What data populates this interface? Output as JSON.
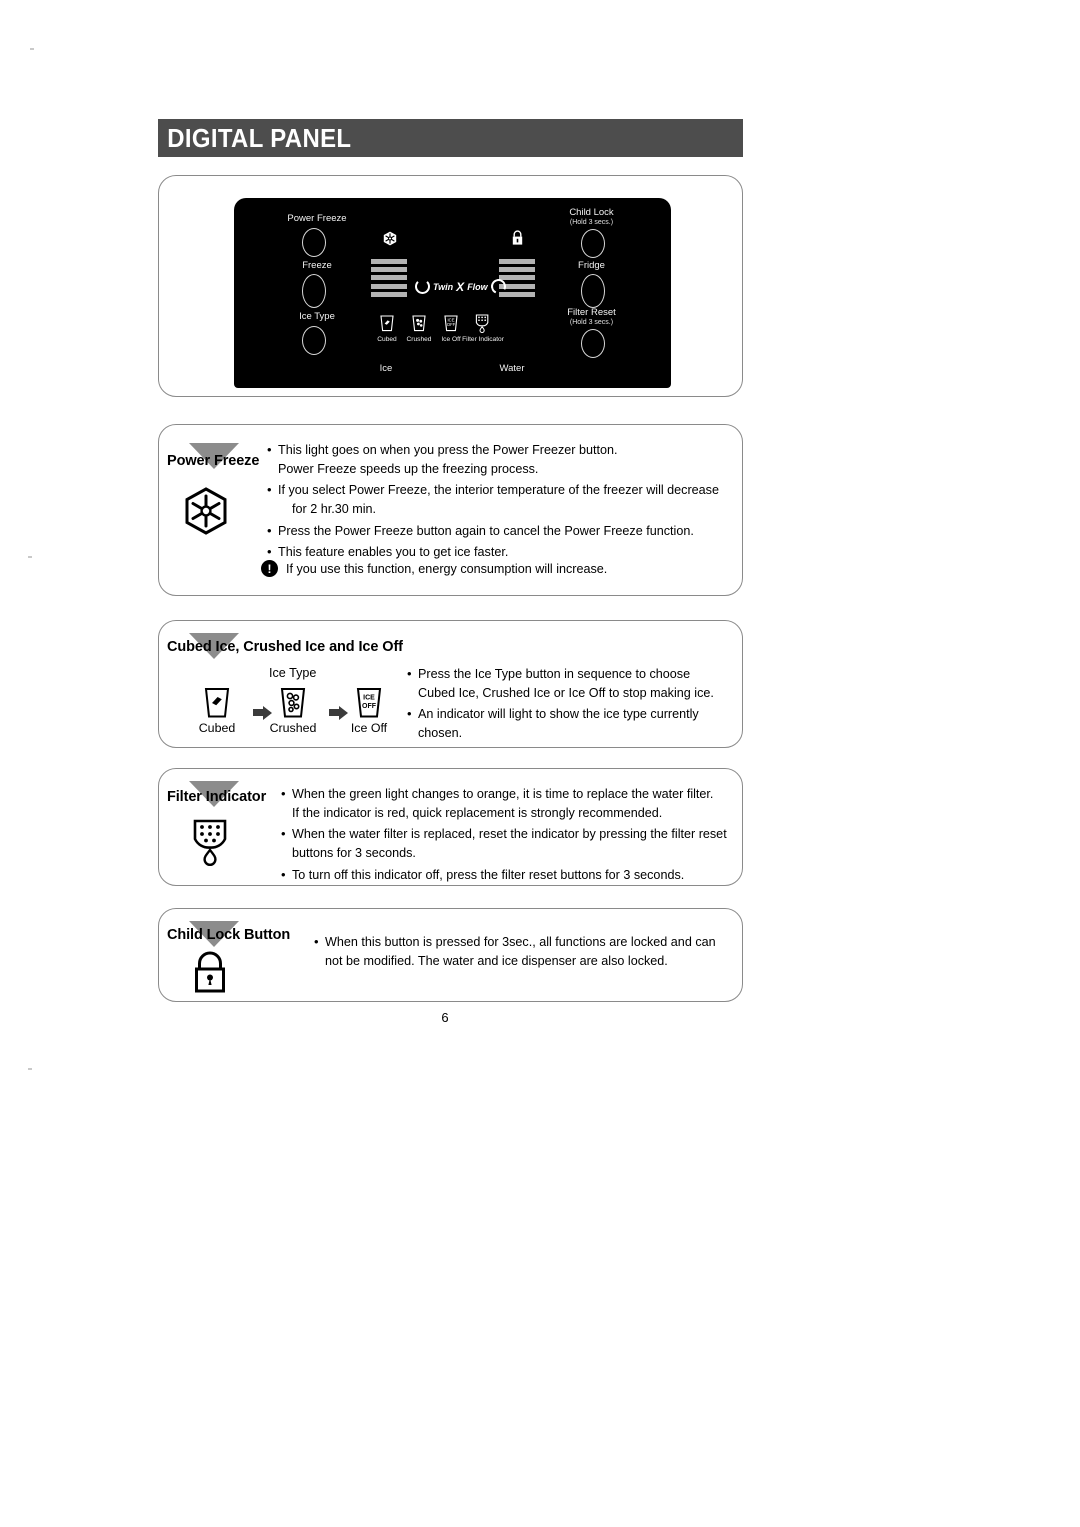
{
  "header": {
    "title": "DIGITAL PANEL"
  },
  "panel": {
    "left_buttons": [
      {
        "label": "Power Freeze"
      },
      {
        "label": "Freeze"
      },
      {
        "label": "Ice Type"
      }
    ],
    "right_buttons": [
      {
        "label": "Child Lock",
        "sub": "(Hold 3 secs.)"
      },
      {
        "label": "Fridge",
        "sub": ""
      },
      {
        "label": "Filter Reset",
        "sub": "(Hold 3 secs.)"
      }
    ],
    "logo": {
      "word1": "Twin",
      "x": "X",
      "word2": "Flow"
    },
    "indicator_labels": [
      "Cubed",
      "Crushed",
      "Ice Off",
      "Filter Indicator"
    ],
    "bottom_labels": {
      "ice": "Ice",
      "water": "Water"
    },
    "icons": {
      "snowflake": "snowflake-icon",
      "lock": "padlock-icon"
    }
  },
  "power_freeze": {
    "tag": "Power Freeze",
    "bullets": [
      {
        "line1": "This light goes on when you press the Power Freezer button.",
        "line2": "Power Freeze speeds up the freezing process."
      },
      {
        "line1": "If you select Power Freeze, the interior temperature of the freezer will decrease",
        "line2": "for 2 hr.30 min."
      },
      {
        "line1": "Press the Power Freeze button again to cancel the Power Freeze function.",
        "line2": ""
      },
      {
        "line1": "This feature enables you to get ice faster.",
        "line2": ""
      }
    ],
    "note": "If you use this function, energy consumption will increase."
  },
  "ice_type": {
    "title": "Cubed Ice, Crushed Ice and Ice Off",
    "sub_title": "Ice Type",
    "steps": [
      "Cubed",
      "Crushed",
      "Ice Off"
    ],
    "ice_off_glyph": {
      "line1": "ICE",
      "line2": "OFF"
    },
    "bullets": [
      {
        "line1": "Press the Ice Type button in sequence to choose",
        "line2": "Cubed Ice, Crushed Ice or Ice Off to stop making ice."
      },
      {
        "line1": "An indicator will light to show the ice type currently",
        "line2": "chosen."
      }
    ]
  },
  "filter_indicator": {
    "tag": "Filter Indicator",
    "bullets": [
      {
        "line1": "When the green light changes to orange, it is time to replace the water filter.",
        "line2": "If the indicator is red, quick replacement is strongly recommended."
      },
      {
        "line1": "When the water filter is replaced, reset the indicator by pressing the filter reset",
        "line2": "buttons for 3 seconds."
      },
      {
        "line1": "To turn off this indicator off, press the filter reset buttons for 3 seconds.",
        "line2": ""
      }
    ]
  },
  "child_lock": {
    "tag": "Child Lock Button",
    "bullets": [
      {
        "line1": "When this button is pressed for 3sec., all functions are locked and can",
        "line2": "not be modified. The water and ice dispenser are also locked."
      }
    ]
  },
  "page_number": "6"
}
